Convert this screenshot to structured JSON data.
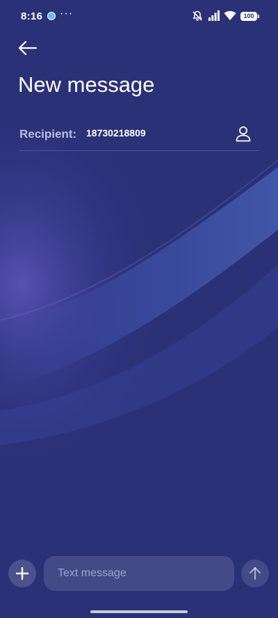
{
  "status_bar": {
    "time": "8:16",
    "overflow": "···",
    "battery": "100",
    "icons": [
      "app-notification-icon",
      "bell-muted-icon",
      "signal-icon",
      "wifi-icon",
      "battery-icon"
    ]
  },
  "header": {
    "back_icon": "arrow-left-icon",
    "title": "New message"
  },
  "recipient": {
    "label": "Recipient:",
    "value": "18730218809",
    "contact_icon": "person-icon"
  },
  "composer": {
    "add_icon": "plus-icon",
    "placeholder": "Text message",
    "value": "",
    "send_icon": "arrow-up-icon"
  },
  "colors": {
    "background": "#2a3176",
    "wave_highlight": "#5a56b8",
    "text": "#ffffff"
  }
}
